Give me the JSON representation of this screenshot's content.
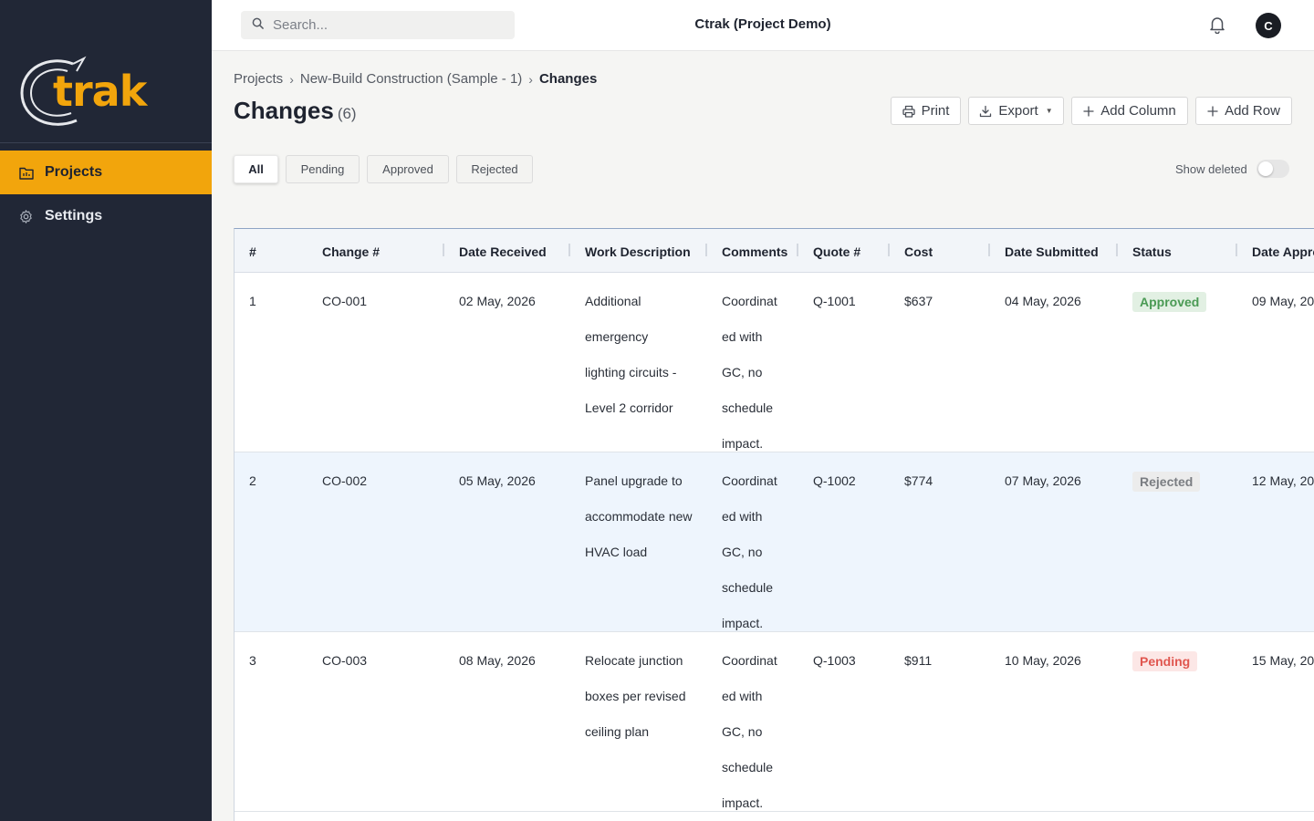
{
  "app": {
    "logo_text": "trak",
    "title": "Ctrak (Project Demo)",
    "avatar_initial": "C",
    "accent_color": "#f2a50c"
  },
  "sidebar": {
    "items": [
      {
        "label": "Projects",
        "icon": "folder-icon",
        "active": true
      },
      {
        "label": "Settings",
        "icon": "gear-icon",
        "active": false
      }
    ]
  },
  "search": {
    "placeholder": "Search...",
    "value": ""
  },
  "breadcrumb": [
    "Projects",
    "New-Build Construction (Sample - 1)",
    "Changes"
  ],
  "page": {
    "title": "Changes",
    "count": "(6)"
  },
  "actions": {
    "print": "Print",
    "export": "Export",
    "add_column": "Add Column",
    "add_row": "Add Row"
  },
  "filters": [
    "All",
    "Pending",
    "Approved",
    "Rejected"
  ],
  "show_deleted": {
    "label": "Show deleted",
    "on": false
  },
  "table": {
    "columns": [
      "#",
      "Change #",
      "Date Received",
      "Work Description",
      "Comments",
      "Quote #",
      "Cost",
      "Date Submitted",
      "Status",
      "Date Appro"
    ],
    "rows": [
      {
        "num": "1",
        "change": "CO-001",
        "received": "02 May, 2026",
        "desc": [
          "Additional",
          "emergency",
          "lighting circuits -",
          "Level 2 corridor"
        ],
        "comments": [
          "Coordinat",
          "ed with",
          "GC, no",
          "schedule",
          "impact."
        ],
        "quote": "Q-1001",
        "cost": "$637",
        "submitted": "04 May, 2026",
        "status": "Approved",
        "status_class": "approved",
        "approved": "09 May, 20"
      },
      {
        "num": "2",
        "change": "CO-002",
        "received": "05 May, 2026",
        "desc": [
          "Panel upgrade to",
          "accommodate new",
          "HVAC load"
        ],
        "comments": [
          "Coordinat",
          "ed with",
          "GC, no",
          "schedule",
          "impact."
        ],
        "quote": "Q-1002",
        "cost": "$774",
        "submitted": "07 May, 2026",
        "status": "Rejected",
        "status_class": "rejected",
        "approved": "12 May, 20"
      },
      {
        "num": "3",
        "change": "CO-003",
        "received": "08 May, 2026",
        "desc": [
          "Relocate junction",
          "boxes per revised",
          "ceiling plan"
        ],
        "comments": [
          "Coordinat",
          "ed with",
          "GC, no",
          "schedule",
          "impact."
        ],
        "quote": "Q-1003",
        "cost": "$911",
        "submitted": "10 May, 2026",
        "status": "Pending",
        "status_class": "pending",
        "approved": "15 May, 20"
      }
    ]
  }
}
